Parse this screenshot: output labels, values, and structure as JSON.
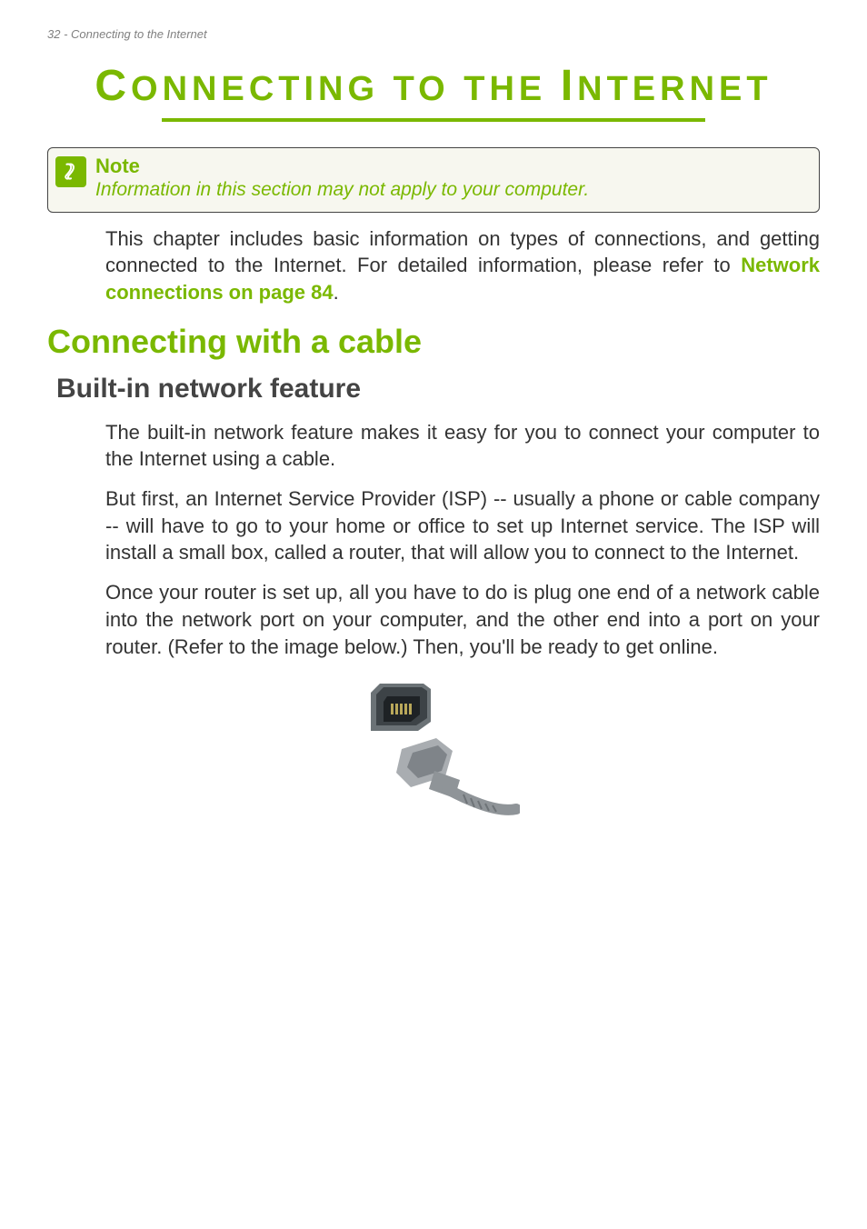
{
  "header": {
    "text": "32 - Connecting to the Internet"
  },
  "title": {
    "c1": "C",
    "w1": "ONNECTING",
    "w2": " TO",
    "w3": " THE ",
    "c2": "I",
    "w4": "NTERNET"
  },
  "note": {
    "title": "Note",
    "body": "Information in this section may not apply to your computer."
  },
  "intro": {
    "text_a": "This chapter includes basic information on types of connections, and getting connected to the Internet. For detailed information, please refer to ",
    "link": "Network connections on page 84",
    "text_b": "."
  },
  "h2": "Connecting with a cable",
  "h3": "Built-in network feature",
  "para1": "The built-in network feature makes it easy for you to connect your computer to the Internet using a cable.",
  "para2": "But first, an Internet Service Provider (ISP) -- usually a phone or cable company -- will have to go to your home or office to set up Internet service. The ISP will install a small box, called a router, that will allow you to connect to the Internet.",
  "para3": "Once your router is set up, all you have to do is plug one end of a network cable into the network port on your computer, and the other end into a port on your router. (Refer to the image below.) Then, you'll be ready to get online."
}
